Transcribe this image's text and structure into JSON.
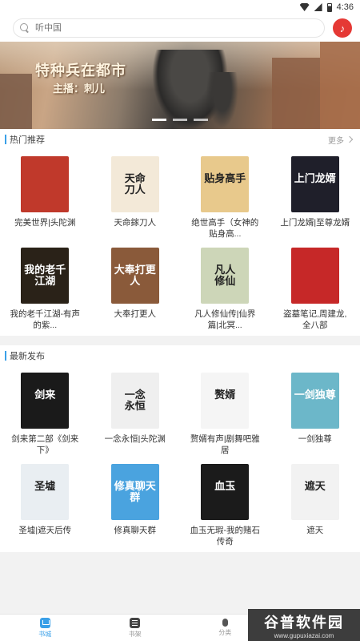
{
  "status": {
    "time": "4:36"
  },
  "search": {
    "placeholder": "听中国"
  },
  "banner": {
    "title": "特种兵在都市",
    "host": "主播：刺儿"
  },
  "hot": {
    "title": "热门推荐",
    "more": "更多",
    "items": [
      {
        "label": "完美世界|头陀渊",
        "cover_text": "",
        "bg": "#c0392b"
      },
      {
        "label": "天命鎵刀人",
        "cover_text": "天命\n刀人",
        "bg": "#f3e9d8"
      },
      {
        "label": "绝世高手（女神的贴身高...",
        "cover_text": "贴身高手",
        "bg": "#e8c98c"
      },
      {
        "label": "上门龙婿|至尊龙婿",
        "cover_text": "上门龙婿",
        "bg": "#1f1f2a"
      },
      {
        "label": "我的老千江湖-有声的紫...",
        "cover_text": "我的老千\n江湖",
        "bg": "#2a2218"
      },
      {
        "label": "大奉打更人",
        "cover_text": "大奉打更人",
        "bg": "#8a5a3a"
      },
      {
        "label": "凡人修仙传|仙界篇|北冥...",
        "cover_text": "凡人\n修仙",
        "bg": "#cdd6b8"
      },
      {
        "label": "盗墓笔记,周建龙,全八部",
        "cover_text": "",
        "bg": "#c62828"
      }
    ]
  },
  "latest": {
    "title": "最新发布",
    "items": [
      {
        "label": "剑来第二部《剑来下》",
        "cover_text": "剑来",
        "bg": "#1a1a1a"
      },
      {
        "label": "一念永恒|头陀渊",
        "cover_text": "一念\n永恒",
        "bg": "#efefef"
      },
      {
        "label": "赘婿有声|剧舞吧雅居",
        "cover_text": "赘婿",
        "bg": "#f5f5f5"
      },
      {
        "label": "一剑独尊",
        "cover_text": "一剑独尊",
        "bg": "#6cb7c9"
      },
      {
        "label": "圣墟|遮天后传",
        "cover_text": "圣墟",
        "bg": "#e9eef2"
      },
      {
        "label": "修真聊天群",
        "cover_text": "修真聊天群",
        "bg": "#4aa3df"
      },
      {
        "label": "血玉无瑕-我的赌石传奇",
        "cover_text": "血玉",
        "bg": "#1b1b1b"
      },
      {
        "label": "遮天",
        "cover_text": "遮天",
        "bg": "#f2f2f2"
      }
    ]
  },
  "tabs": [
    {
      "label": "书城"
    },
    {
      "label": "书架"
    },
    {
      "label": "分类"
    }
  ],
  "watermark": {
    "logo": "谷普软件园",
    "url": "www.gupuxiazai.com"
  }
}
